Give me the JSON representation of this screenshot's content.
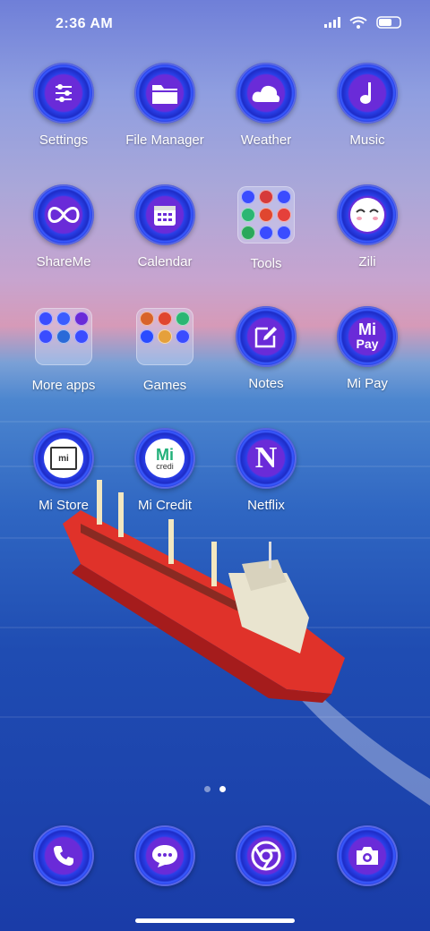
{
  "status_bar": {
    "time": "2:36 AM"
  },
  "apps": [
    {
      "label": "Settings",
      "icon": "sliders-icon"
    },
    {
      "label": "File Manager",
      "icon": "folder-icon"
    },
    {
      "label": "Weather",
      "icon": "cloud-icon"
    },
    {
      "label": "Music",
      "icon": "music-note-icon"
    },
    {
      "label": "ShareMe",
      "icon": "infinity-icon"
    },
    {
      "label": "Calendar",
      "icon": "calendar-icon"
    },
    {
      "label": "Tools",
      "icon": "folder-grid-icon"
    },
    {
      "label": "Zili",
      "icon": "face-icon"
    },
    {
      "label": "More apps",
      "icon": "folder-grid-icon"
    },
    {
      "label": "Games",
      "icon": "folder-grid-icon"
    },
    {
      "label": "Notes",
      "icon": "note-edit-icon"
    },
    {
      "label": "Mi Pay",
      "icon": "mi-pay-icon",
      "icon_text_1": "Mi",
      "icon_text_2": "Pay"
    },
    {
      "label": "Mi Store",
      "icon": "shopping-bag-icon",
      "icon_text": "mi"
    },
    {
      "label": "Mi Credit",
      "icon": "mi-credit-icon",
      "icon_text_1": "Mi",
      "icon_text_2": "credi"
    },
    {
      "label": "Netflix",
      "icon": "netflix-icon",
      "icon_text": "N"
    }
  ],
  "dock": [
    {
      "icon": "phone-icon"
    },
    {
      "icon": "message-icon"
    },
    {
      "icon": "chrome-icon"
    },
    {
      "icon": "camera-icon"
    }
  ],
  "page_indicator": {
    "count": 2,
    "active": 2
  },
  "colors": {
    "ring": "#2a3fe8",
    "ring_inner": "#6a2bd8",
    "label": "#ffffff"
  }
}
